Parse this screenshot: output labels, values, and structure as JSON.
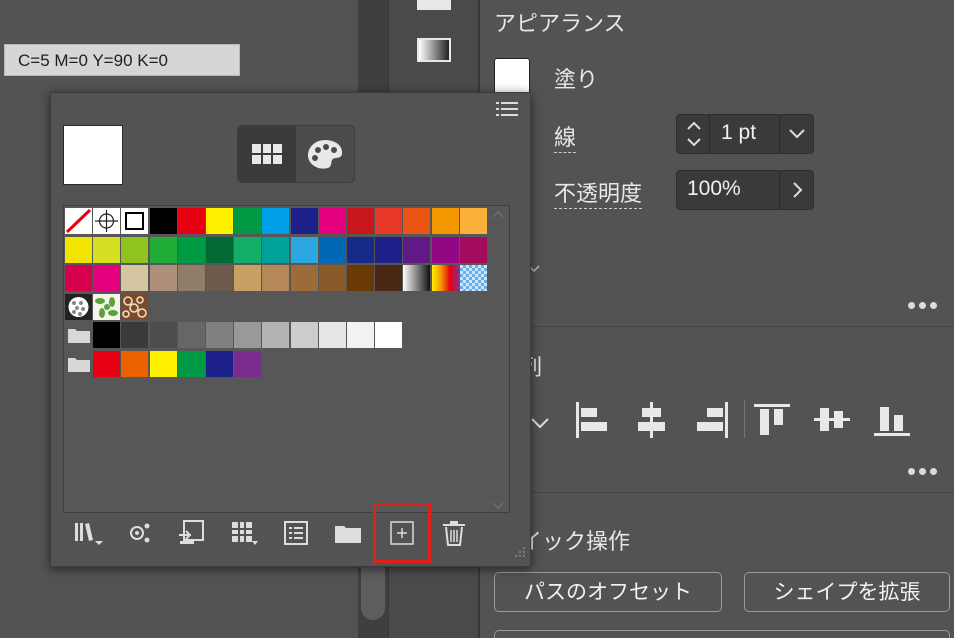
{
  "tooltip": {
    "text": "C=5 M=0 Y=90 K=0"
  },
  "appearance": {
    "title": "アピアランス",
    "fill_label": "塗り",
    "stroke_label": "線",
    "stroke_value": "1 pt",
    "opacity_label": "不透明度",
    "opacity_value": "100%"
  },
  "align": {
    "title_partial": "列"
  },
  "quick_actions": {
    "title_partial": "イック操作",
    "offset_button": "パスのオフセット",
    "expand_button": "シェイプを拡張"
  },
  "swatches": {
    "rows": [
      [
        "none",
        "register",
        "white",
        "#000000",
        "#e60012",
        "#fff100",
        "#009944",
        "#00a0e9",
        "#1d2088",
        "#e4007f",
        "#c8161d",
        "#e83828",
        "#ea5514",
        "#f39800",
        "#fbb03b"
      ],
      [
        "#f4e500",
        "#d7df23",
        "#8fc31f",
        "#22ac38",
        "#009944",
        "#006934",
        "#13ae67",
        "#00a29a",
        "#2ca6e0",
        "#0068b7",
        "#172a88",
        "#1d2088",
        "#601986",
        "#920783",
        "#a40b5d"
      ],
      [
        "#d7004f",
        "#e4007f",
        "#d5c5a1",
        "#ad8f7a",
        "#8f7d6a",
        "#6d5a4a",
        "#c8a063",
        "#b5885a",
        "#9b6b3a",
        "#8a5a2b",
        "#6a3906",
        "#4a2712",
        "gradient-gray",
        "gradient-orange",
        "pattern-blue"
      ]
    ],
    "pattern_row": [
      "pattern-dots",
      "pattern-leaves",
      "pattern-pebbles"
    ],
    "gray_group": [
      "#000000",
      "#3a3a3a",
      "#4d4d4d",
      "#666666",
      "#808080",
      "#999999",
      "#b3b3b3",
      "#cccccc",
      "#e6e6e6",
      "#f2f2f2",
      "#ffffff"
    ],
    "color_group": [
      "#e60012",
      "#eb6100",
      "#fff100",
      "#009944",
      "#1d2088",
      "#7b2d8e"
    ],
    "view_icons": [
      "grid-view-icon",
      "color-palette-icon"
    ],
    "bottom_icons": [
      "library-icon",
      "swatch-kind-icon",
      "place-swatch-icon",
      "swatch-options-icon",
      "new-color-group-icon",
      "new-swatch-icon",
      "delete-swatch-icon"
    ]
  },
  "colors": {
    "highlight": "#e0201b",
    "panel_bg": "#535353"
  }
}
